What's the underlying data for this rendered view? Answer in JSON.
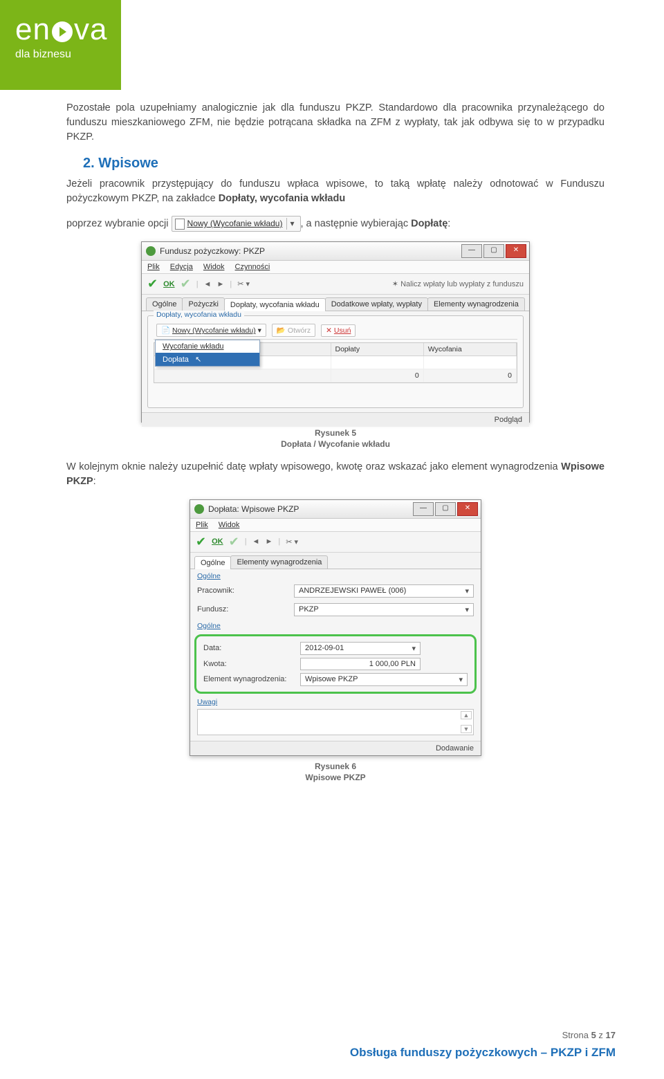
{
  "logo": {
    "brand_left": "en",
    "brand_right": "va",
    "sub": "dla biznesu"
  },
  "para1": "Pozostałe pola uzupełniamy analogicznie jak dla funduszu PKZP. Standardowo dla pracownika przynależącego do funduszu mieszkaniowego ZFM, nie będzie potrącana składka na ZFM z wypłaty, tak jak odbywa się to w przypadku PKZP.",
  "heading": "2. Wpisowe",
  "para2_a": "Jeżeli pracownik przystępujący do funduszu wpłaca wpisowe, to taką wpłatę należy odnotować w Funduszu pożyczkowym PKZP, na zakładce ",
  "para2_b_bold": "Dopłaty, wycofania wkładu",
  "para2_c": "poprzez wybranie opcji ",
  "inline_btn": {
    "label": "Nowy (Wycofanie wkładu)"
  },
  "para2_d": ", a następnie wybierając ",
  "para2_e_bold": "Dopłatę",
  "para2_f": ":",
  "shot1": {
    "title": "Fundusz pożyczkowy: PKZP",
    "menu": [
      "Plik",
      "Edycja",
      "Widok",
      "Czynności"
    ],
    "ok": "OK",
    "tool_right": "Nalicz wpłaty lub wypłaty z funduszu",
    "tabs": [
      "Ogólne",
      "Pożyczki",
      "Dopłaty, wycofania wkładu",
      "Dodatkowe wpłaty, wypłaty",
      "Elementy wynagrodzenia"
    ],
    "group": "Dopłaty, wycofania wkładu",
    "list_new": "Nowy (Wycofanie wkładu)",
    "list_open": "Otwórz",
    "list_del": "Usuń",
    "menu_items": [
      "Wycofanie wkładu",
      "Dopłata"
    ],
    "cols": [
      "",
      "Dopłaty",
      "Wycofania"
    ],
    "row": [
      "",
      "0",
      "0"
    ],
    "status": "Podgląd"
  },
  "cap1a": "Rysunek 5",
  "cap1b": "Dopłata / Wycofanie wkładu",
  "para3_a": "W kolejnym oknie należy uzupełnić datę wpłaty wpisowego, kwotę oraz wskazać jako element wynagrodzenia ",
  "para3_b_bold": "Wpisowe PKZP",
  "para3_c": ":",
  "shot2": {
    "title": "Dopłata: Wpisowe PKZP",
    "menu": [
      "Plik",
      "Widok"
    ],
    "ok": "OK",
    "tabs": [
      "Ogólne",
      "Elementy wynagrodzenia"
    ],
    "g1": "Ogólne",
    "r1": {
      "label": "Pracownik:",
      "val": "ANDRZEJEWSKI PAWEŁ (006)"
    },
    "r2": {
      "label": "Fundusz:",
      "val": "PKZP"
    },
    "g2": "Ogólne",
    "r3": {
      "label": "Data:",
      "val": "2012-09-01"
    },
    "r4": {
      "label": "Kwota:",
      "val": "1 000,00 PLN"
    },
    "r5": {
      "label": "Element wynagrodzenia:",
      "val": "Wpisowe PKZP"
    },
    "g3": "Uwagi",
    "status": "Dodawanie"
  },
  "cap2a": "Rysunek 6",
  "cap2b": "Wpisowe PKZP",
  "footer": {
    "page": "Strona 5 z 17",
    "title": "Obsługa funduszy pożyczkowych – PKZP i ZFM"
  }
}
